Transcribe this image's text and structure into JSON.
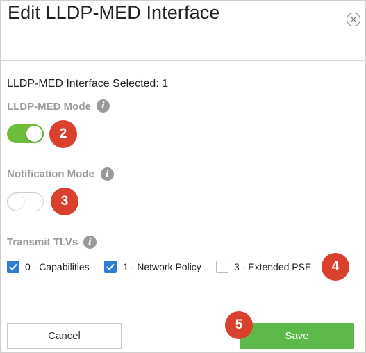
{
  "dialog": {
    "title": "Edit LLDP-MED Interface",
    "selected_text": "LLDP-MED Interface Selected: 1"
  },
  "fields": {
    "lldp_med_mode": {
      "label": "LLDP-MED Mode",
      "enabled": true,
      "step": "2"
    },
    "notification_mode": {
      "label": "Notification Mode",
      "enabled": false,
      "step": "3"
    },
    "transmit_tlvs": {
      "label": "Transmit TLVs",
      "options": [
        {
          "label": "0 - Capabilities",
          "checked": true
        },
        {
          "label": "1 - Network Policy",
          "checked": true
        },
        {
          "label": "3 - Extended PSE",
          "checked": false
        }
      ],
      "step": "4"
    }
  },
  "footer": {
    "cancel_label": "Cancel",
    "save_label": "Save",
    "step": "5"
  },
  "icons": {
    "info": "info-icon",
    "close": "close-icon",
    "check": "check-icon"
  },
  "colors": {
    "toggle_on": "#6ebd3a",
    "badge": "#d9412d",
    "checkbox_checked": "#2e7fd1",
    "save_button": "#5db94a",
    "label_gray": "#9a9a9a"
  }
}
